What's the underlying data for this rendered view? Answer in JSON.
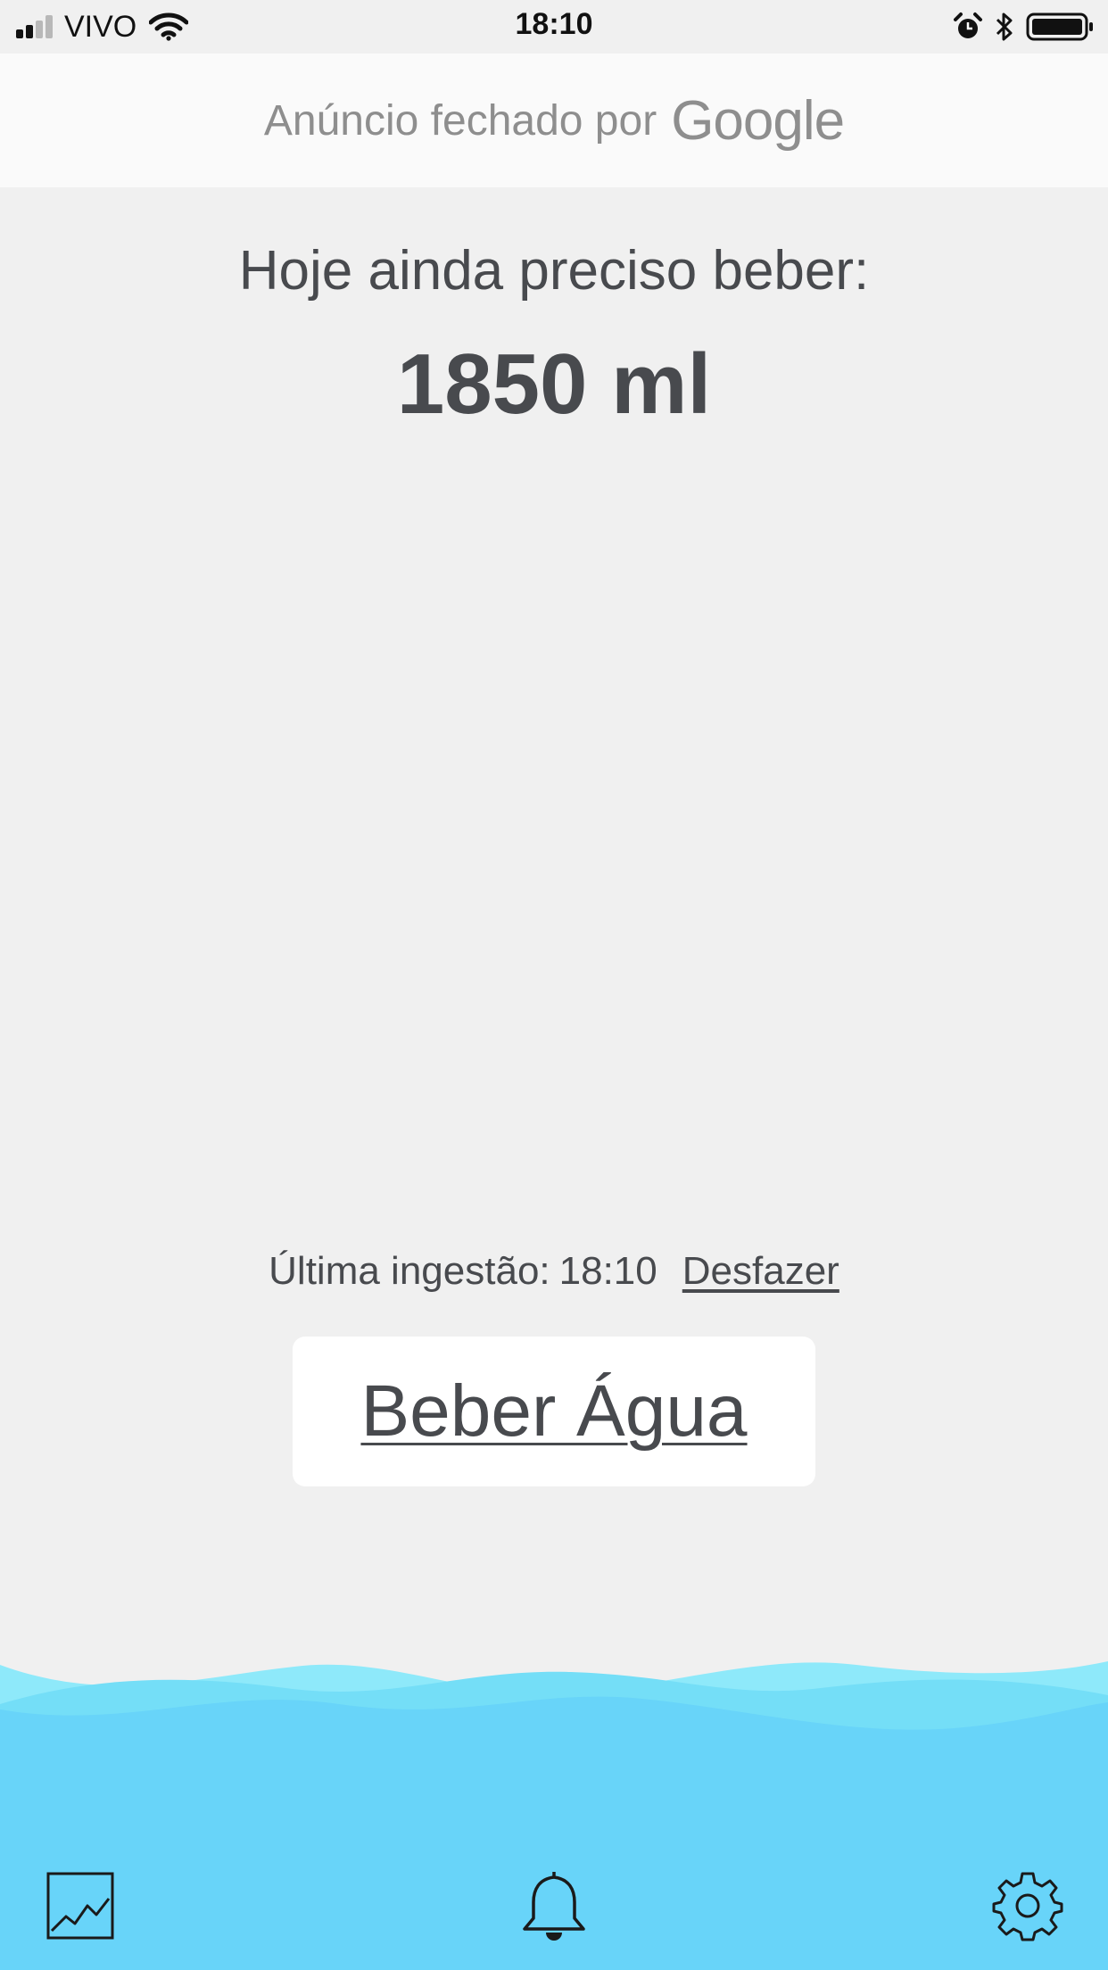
{
  "status_bar": {
    "carrier": "VIVO",
    "time": "18:10",
    "signal_bars_filled": 2,
    "signal_bars_total": 4,
    "battery_level": 1.0,
    "icons": [
      "signal-icon",
      "wifi-icon",
      "alarm-icon",
      "bluetooth-icon",
      "battery-icon"
    ]
  },
  "ad": {
    "text": "Anúncio fechado por",
    "brand": "Google"
  },
  "main": {
    "remaining_label": "Hoje ainda preciso beber:",
    "remaining_value": "1850 ml"
  },
  "last_intake": {
    "label": "Última ingestão:",
    "time": "18:10",
    "undo_label": "Desfazer"
  },
  "drink_button": {
    "label": "Beber Água"
  },
  "bottom_nav": {
    "icons": [
      "chart-icon",
      "bell-icon",
      "gear-icon"
    ]
  },
  "colors": {
    "background": "#f0f0f0",
    "text": "#484a4e",
    "ad_background": "#fafafa",
    "wave_light": "#8ee9fa",
    "wave_mid": "#74def7",
    "wave_main": "#68d4f9"
  }
}
